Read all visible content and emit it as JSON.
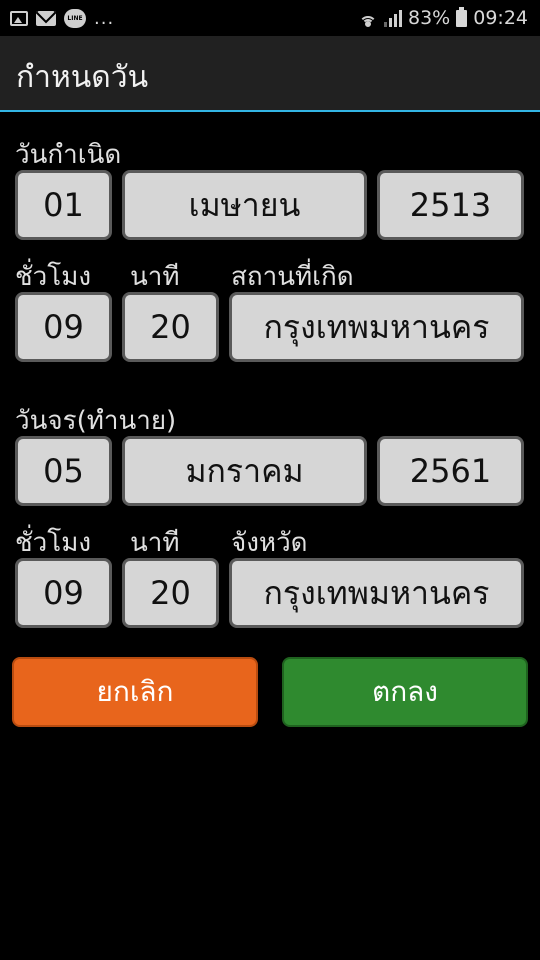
{
  "status_bar": {
    "overflow_dots": "...",
    "battery": "83%",
    "time": "09:24",
    "line_badge": "LINE"
  },
  "app_bar": {
    "title": "กำหนดวัน"
  },
  "birth": {
    "section_label": "วันกำเนิด",
    "day": "01",
    "month": "เมษายน",
    "year": "2513",
    "hour_label": "ชั่วโมง",
    "minute_label": "นาที",
    "place_label": "สถานที่เกิด",
    "hour": "09",
    "minute": "20",
    "place": "กรุงเทพมหานคร"
  },
  "transit": {
    "section_label": "วันจร(ทำนาย)",
    "day": "05",
    "month": "มกราคม",
    "year": "2561",
    "hour_label": "ชั่วโมง",
    "minute_label": "นาที",
    "province_label": "จังหวัด",
    "hour": "09",
    "minute": "20",
    "province": "กรุงเทพมหานคร"
  },
  "actions": {
    "cancel_label": "ยกเลิก",
    "ok_label": "ตกลง"
  },
  "colors": {
    "accent_line": "#33b5e5",
    "cancel_button": "#e8651c",
    "ok_button": "#2f8a2f",
    "field_background": "#d6d6d6"
  },
  "icons": [
    "image-icon",
    "mail-icon",
    "line-app-icon",
    "wifi-icon",
    "signal-icon",
    "battery-icon"
  ]
}
